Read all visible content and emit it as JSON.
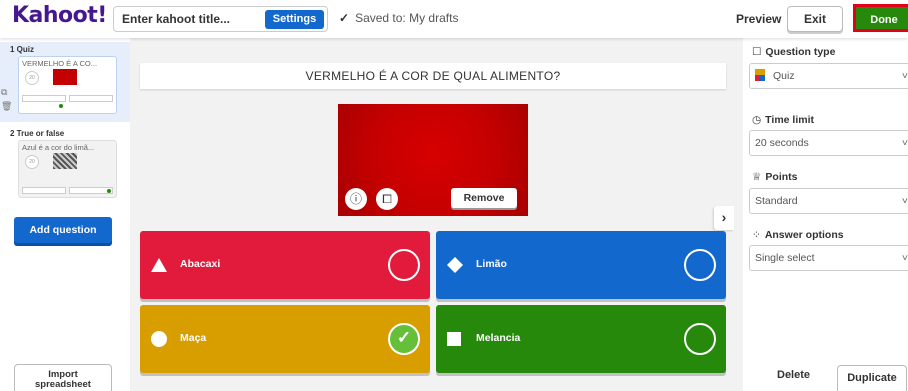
{
  "header": {
    "logo": "Kahoot!",
    "title_placeholder": "Enter kahoot title...",
    "settings_label": "Settings",
    "saved_text": "Saved to: My drafts",
    "preview_label": "Preview",
    "exit_label": "Exit",
    "done_label": "Done"
  },
  "sidebar": {
    "slides": [
      {
        "label": "1 Quiz",
        "title": "VERMELHO É A CO...",
        "time": "20"
      },
      {
        "label": "2 True or false",
        "title": "Azul é a cor do limã...",
        "time": "20"
      }
    ],
    "add_question_label": "Add question",
    "import_label_line1": "Import",
    "import_label_line2": "spreadsheet"
  },
  "question": {
    "title": "VERMELHO É A COR DE QUAL ALIMENTO?",
    "remove_label": "Remove",
    "answers": [
      {
        "text": "Abacaxi",
        "color": "#e21b3c",
        "shape": "triangle",
        "correct": false
      },
      {
        "text": "Limão",
        "color": "#1368ce",
        "shape": "diamond",
        "correct": false
      },
      {
        "text": "Maça",
        "color": "#d89e00",
        "shape": "circle",
        "correct": true
      },
      {
        "text": "Melancia",
        "color": "#26890c",
        "shape": "square",
        "correct": false
      }
    ]
  },
  "panel": {
    "question_type_label": "Question type",
    "question_type_value": "Quiz",
    "time_limit_label": "Time limit",
    "time_limit_value": "20 seconds",
    "points_label": "Points",
    "points_value": "Standard",
    "answer_options_label": "Answer options",
    "answer_options_value": "Single select",
    "delete_label": "Delete",
    "duplicate_label": "Duplicate"
  }
}
